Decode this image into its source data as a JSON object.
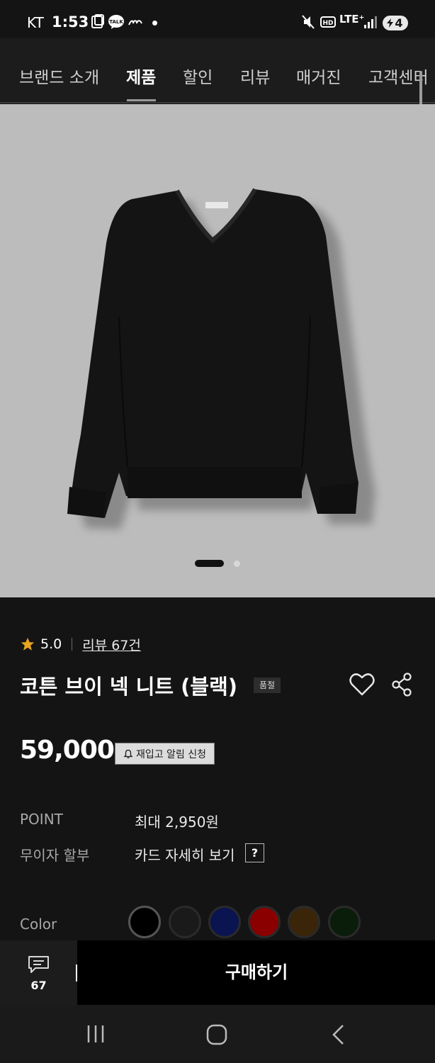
{
  "status_bar": {
    "carrier": "KT",
    "time": "1:53",
    "network": "LTE⁺",
    "battery": "4"
  },
  "nav": {
    "tabs": [
      "브랜드 소개",
      "제품",
      "할인",
      "리뷰",
      "매거진",
      "고객센터"
    ],
    "active_index": 1
  },
  "hero": {
    "slide_count": 2,
    "active_slide": 1
  },
  "product": {
    "rating": "5.0",
    "review_link": "리뷰 67건",
    "title": "코튼 브이 넥 니트 (블랙)",
    "badge": "품절",
    "price": "59,000",
    "restock_label": "재입고 알림 신청",
    "point_label": "POINT",
    "point_value": "최대 2,950원",
    "installment_label": "무이자 할부",
    "installment_value": "카드 자세히 보기",
    "help_symbol": "?",
    "color_label": "Color",
    "swatches": [
      "#000000",
      "#1a1a1a",
      "#0a1450",
      "#8a0000",
      "#3a2508",
      "#0a1c0a"
    ],
    "selected_swatch": 0
  },
  "action_bar": {
    "review_count": "67",
    "buy_label": "구매하기"
  },
  "colors": {
    "background": "#141414",
    "star": "#e8a321",
    "hero_bg": "#bcbcbc"
  }
}
